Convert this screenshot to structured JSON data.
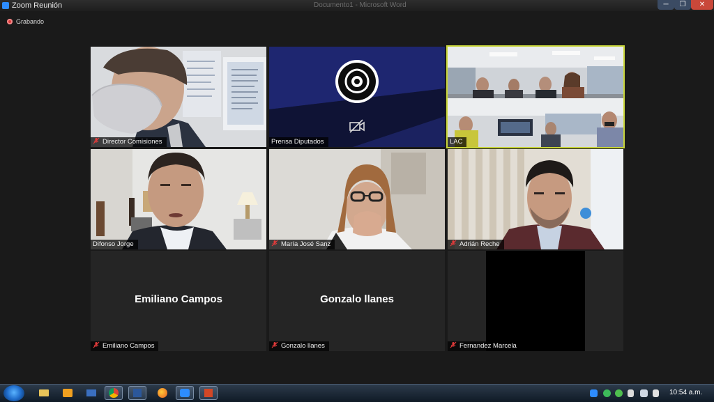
{
  "window": {
    "title": "Zoom Reunión",
    "background_doc_title": "Documento1 - Microsoft Word",
    "controls": {
      "minimize": "─",
      "maximize": "❐",
      "close": "✕"
    }
  },
  "recording": {
    "label": "Grabando",
    "color": "#e03b3b"
  },
  "tiles": [
    {
      "name": "Director Comisiones",
      "muted": true,
      "video": "camera"
    },
    {
      "name": "Prensa Diputados",
      "muted": false,
      "video": "off-logo"
    },
    {
      "name": "LAC",
      "muted": false,
      "video": "camera",
      "active_speaker": true
    },
    {
      "name": "Difonso Jorge",
      "muted": false,
      "video": "camera"
    },
    {
      "name": "María José Sanz",
      "muted": true,
      "video": "camera"
    },
    {
      "name": "Adrián Reche",
      "muted": true,
      "video": "camera"
    },
    {
      "name": "Emiliano Campos",
      "muted": true,
      "video": "off",
      "display_name": "Emiliano Campos"
    },
    {
      "name": "Gonzalo llanes",
      "muted": true,
      "video": "off",
      "display_name": "Gonzalo llanes"
    },
    {
      "name": "Fernandez Marcela",
      "muted": true,
      "video": "black"
    }
  ],
  "colors": {
    "active_speaker_border": "#c9d63a",
    "muted_mic": "#e03b3b",
    "meeting_bg": "#1a1a1a"
  },
  "taskbar": {
    "apps": [
      "explorer-icon",
      "media-player-icon",
      "network-icon",
      "chrome-icon",
      "word-icon",
      "firefox-icon",
      "zoom-icon",
      "powerpoint-icon"
    ],
    "tray_icons": [
      "zoom-tray-icon",
      "network-status-icon",
      "sync-icon",
      "flag-icon",
      "display-icon",
      "volume-icon"
    ],
    "clock": "10:54 a.m."
  }
}
